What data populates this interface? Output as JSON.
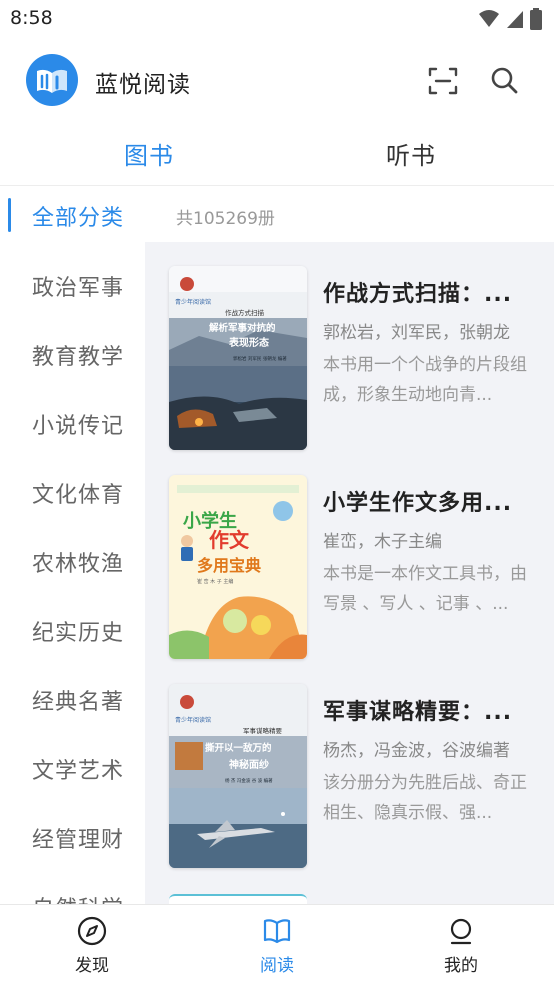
{
  "status_bar": {
    "time": "8:58"
  },
  "app": {
    "title": "蓝悦阅读"
  },
  "main_tabs": [
    {
      "label": "图书",
      "active": true
    },
    {
      "label": "听书",
      "active": false
    }
  ],
  "categories": [
    {
      "label": "全部分类",
      "active": true
    },
    {
      "label": "政治军事"
    },
    {
      "label": "教育教学"
    },
    {
      "label": "小说传记"
    },
    {
      "label": "文化体育"
    },
    {
      "label": "农林牧渔"
    },
    {
      "label": "纪实历史"
    },
    {
      "label": "经典名著"
    },
    {
      "label": "文学艺术"
    },
    {
      "label": "经管理财"
    },
    {
      "label": "自然科学"
    }
  ],
  "total_count": "共105269册",
  "books": [
    {
      "title": "作战方式扫描：...",
      "author": "郭松岩，刘军民，张朝龙",
      "description": "本书用一个个战争的片段组成，形象生动地向青...",
      "cover": {
        "series": "青少年阅读馆",
        "small_title": "作战方式扫描",
        "main_title_line1": "解析军事对抗的",
        "main_title_line2": "表现形态",
        "authors": "郭松岩 刘军民 张朝龙 编著"
      }
    },
    {
      "title": "小学生作文多用...",
      "author": "崔峦，木子主编",
      "description": "本书是一本作文工具书，由写景 、写人 、记事 、...",
      "cover": {
        "line1": "小学生",
        "line2": "作文",
        "line3": "多用宝典",
        "authors": "崔 峦 木 子 主编"
      }
    },
    {
      "title": "军事谋略精要：...",
      "author": "杨杰，冯金波，谷波编著",
      "description": "该分册分为先胜后战、奇正相生、隐真示假、强...",
      "cover": {
        "series": "青少年阅读馆",
        "small_title": "军事谋略精要",
        "main_title_line1": "撕开以一敌万的",
        "main_title_line2": "神秘面纱",
        "authors": "杨 杰 冯金波 谷 波 编著"
      }
    }
  ],
  "bottom_nav": [
    {
      "label": "发现",
      "icon": "compass-icon",
      "active": false
    },
    {
      "label": "阅读",
      "icon": "book-open-icon",
      "active": true
    },
    {
      "label": "我的",
      "icon": "person-icon",
      "active": false
    }
  ],
  "colors": {
    "accent": "#2b8ae8",
    "panel_bg": "#f2f3f7"
  }
}
